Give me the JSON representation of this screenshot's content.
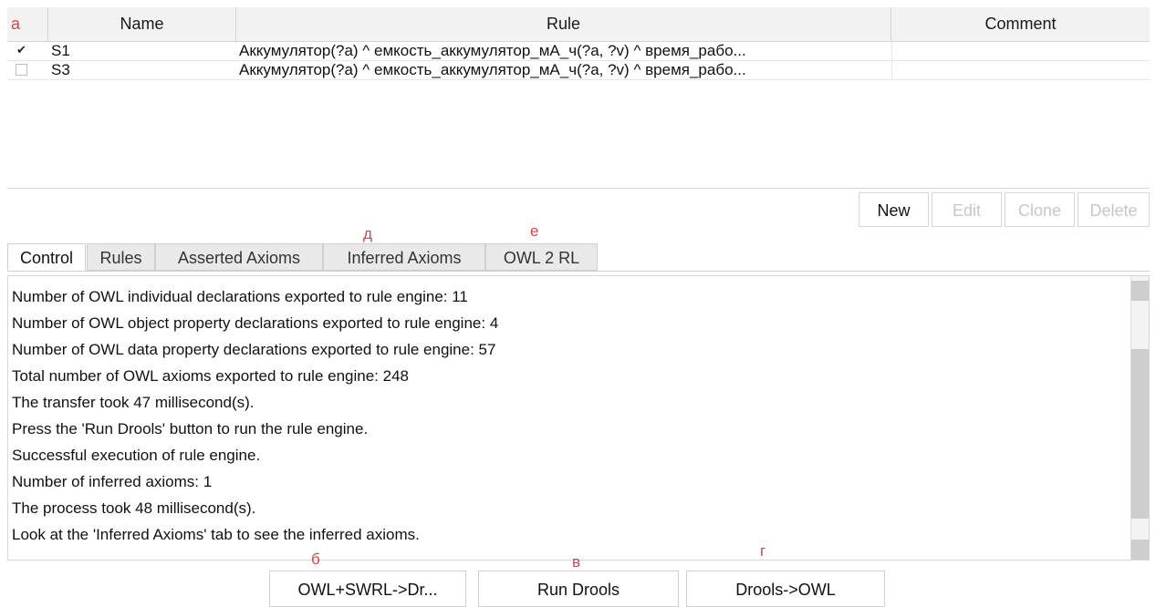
{
  "table": {
    "headers": {
      "marker": "а",
      "name": "Name",
      "rule": "Rule",
      "comment": "Comment"
    },
    "rows": [
      {
        "checked": true,
        "check_glyph": "✔",
        "name": "S1",
        "rule": "Аккумулятор(?a) ^ емкость_аккумулятор_мА_ч(?a, ?v) ^ время_рабо...",
        "comment": ""
      },
      {
        "checked": false,
        "check_glyph": "",
        "name": "S3",
        "rule": "Аккумулятор(?a) ^ емкость_аккумулятор_мА_ч(?a, ?v) ^ время_рабо...",
        "comment": ""
      }
    ]
  },
  "toolbar": {
    "new": "New",
    "edit": "Edit",
    "clone": "Clone",
    "delete": "Delete"
  },
  "tabs": {
    "control": "Control",
    "rules": "Rules",
    "asserted": "Asserted Axioms",
    "inferred": "Inferred Axioms",
    "owl2rl": "OWL 2 RL"
  },
  "markers": {
    "d": "д",
    "e": "е",
    "b": "б",
    "v": "в",
    "g": "г"
  },
  "console": {
    "lines": [
      "Number of OWL individual declarations exported to rule engine: 11",
      "Number of OWL object property declarations exported to rule engine: 4",
      "Number of OWL data property declarations exported to rule engine: 57",
      "Total number of OWL axioms exported to rule engine: 248",
      "The transfer took 47 millisecond(s).",
      "Press the 'Run Drools' button to run the rule engine.",
      "Successful execution of rule engine.",
      "Number of inferred axioms: 1",
      "The process took 48 millisecond(s).",
      "Look at the 'Inferred Axioms' tab to see the inferred axioms."
    ]
  },
  "buttons": {
    "owl_to_drools": "OWL+SWRL->Dr...",
    "run_drools": "Run Drools",
    "drools_to_owl": "Drools->OWL"
  },
  "colors": {
    "marker": "#d64545",
    "disabled_text": "#c6c6c6",
    "tab_inactive": "#e9e9e9"
  }
}
